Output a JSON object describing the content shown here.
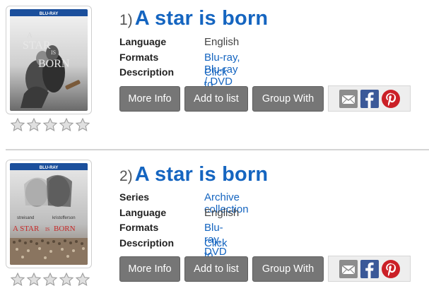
{
  "results": [
    {
      "number": "1)",
      "title": "A star is born",
      "fields": [
        {
          "label": "Language",
          "value": "English",
          "link": false
        },
        {
          "label": "Formats",
          "value": "Blu-ray, Blu-ray / DVD Combo, DVD",
          "link": true
        },
        {
          "label": "Description",
          "value": "Click to view",
          "link": true
        }
      ],
      "rating": 0,
      "cover": {
        "line1": "A",
        "line2": "STAR",
        "line3": "IS",
        "line4": "BORN"
      }
    },
    {
      "number": "2)",
      "title": "A star is born",
      "fields": [
        {
          "label": "Series",
          "value": "Archive collection",
          "link": true
        },
        {
          "label": "Language",
          "value": "English",
          "link": false
        },
        {
          "label": "Formats",
          "value": "Blu-ray, DVD",
          "link": true
        },
        {
          "label": "Description",
          "value": "Click to view",
          "link": true
        }
      ],
      "rating": 0,
      "cover": {
        "names_left": "streisand",
        "names_right": "kristofferson",
        "title_a": "A STAR",
        "title_is": "IS",
        "title_born": "BORN"
      }
    }
  ],
  "buttons": {
    "more_info": "More Info",
    "add_to_list": "Add to list",
    "group_with": "Group With"
  },
  "share_icons": [
    "email-icon",
    "facebook-icon",
    "pinterest-icon"
  ],
  "colors": {
    "title": "#1565c0",
    "link": "#1565c0",
    "button_bg": "#767676",
    "share_bg": "#eeeeee",
    "facebook": "#3b5998",
    "pinterest": "#cb2027"
  },
  "max_stars": 5
}
